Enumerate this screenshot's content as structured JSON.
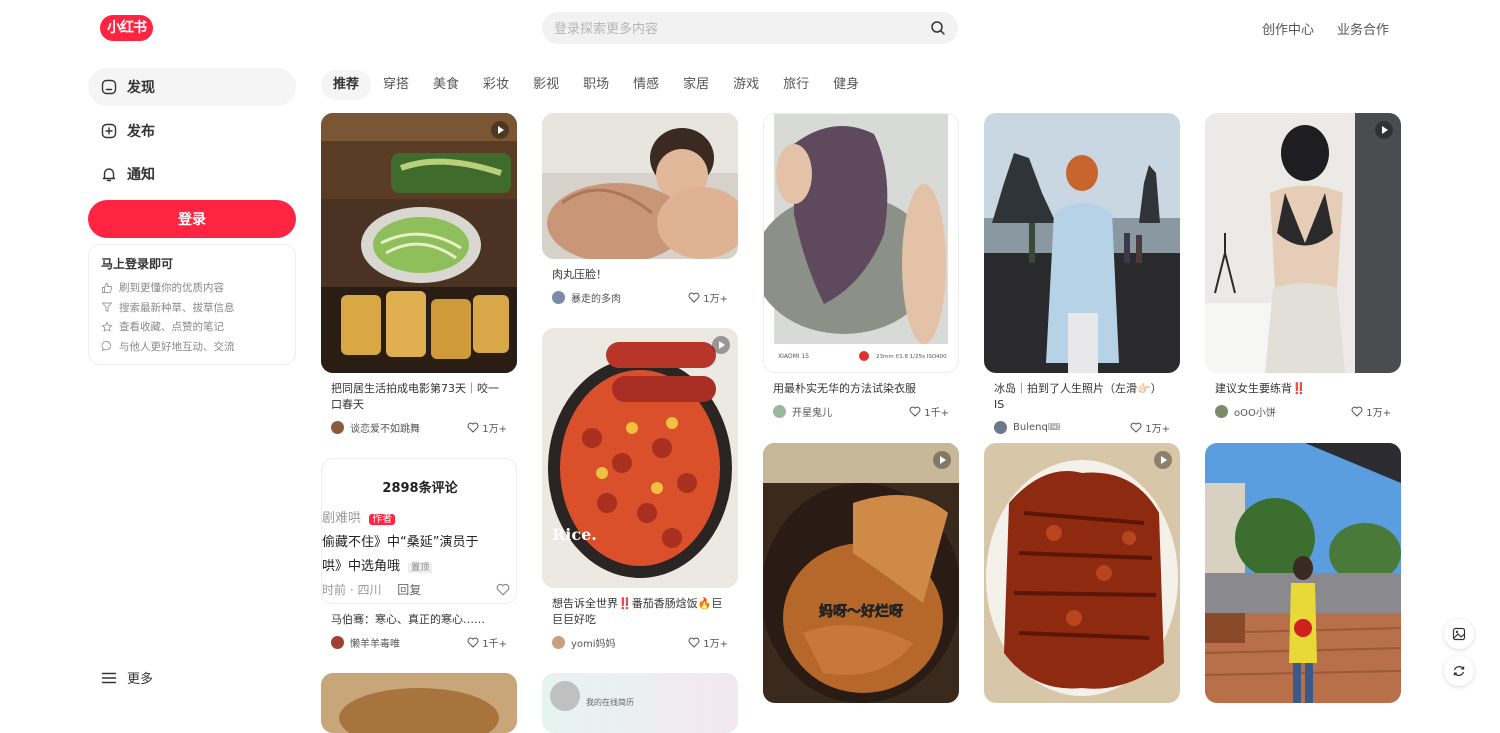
{
  "brand": {
    "logo_text": "小红书",
    "color": "#ff2442"
  },
  "search": {
    "placeholder": "登录探索更多内容"
  },
  "top_links": [
    "创作中心",
    "业务合作"
  ],
  "sidebar": {
    "items": [
      {
        "label": "发现",
        "icon": "home-icon"
      },
      {
        "label": "发布",
        "icon": "plus-square-icon"
      },
      {
        "label": "通知",
        "icon": "bell-icon"
      }
    ],
    "login_button": "登录",
    "login_card": {
      "title": "马上登录即可",
      "benefits": [
        {
          "text": "刷到更懂你的优质内容",
          "icon": "thumb-up-icon"
        },
        {
          "text": "搜索最新种草、拔草信息",
          "icon": "search-filter-icon"
        },
        {
          "text": "查看收藏、点赞的笔记",
          "icon": "star-icon"
        },
        {
          "text": "与他人更好地互动、交流",
          "icon": "chat-bubble-icon"
        }
      ]
    },
    "more": "更多"
  },
  "tabs": [
    "推荐",
    "穿搭",
    "美食",
    "彩妆",
    "影视",
    "职场",
    "情感",
    "家居",
    "游戏",
    "旅行",
    "健身"
  ],
  "feed": {
    "col1": [
      {
        "title": "把同居生活拍成电影第73天｜咬一口春天",
        "author": "谈恋爱不如跳舞",
        "likes": "1万+",
        "video": true
      },
      {
        "title": "马伯骞：寒心、真正的寒心……",
        "author": "懒羊羊毒唯",
        "likes": "1千+",
        "video": false,
        "comment_card": {
          "count": "2898条评论",
          "line1": "剧难哄",
          "tag": "作者",
          "line2": "偷藏不住》中“桑延”演员于",
          "line3": "哄》中选角哦",
          "pin": "置顶",
          "line4": "时前 · 四川",
          "reply": "回复"
        }
      }
    ],
    "col2": [
      {
        "title": "肉丸压脸！",
        "author": "暴走的多肉",
        "likes": "1万+",
        "video": false
      },
      {
        "title": "想告诉全世界‼️番茄香肠焓饭🔥巨巨巨好吃",
        "author": "yomi妈妈",
        "likes": "1万+",
        "video": true,
        "overlay": "Rice."
      },
      {
        "title": "",
        "author": "",
        "likes": "",
        "video": false,
        "overlay": "我的在线简历"
      }
    ],
    "col3": [
      {
        "title": "用最朴实无华的方法试染衣服",
        "author": "开星鬼儿",
        "likes": "1千+",
        "video": false,
        "caption_left": "XIAOMI 15",
        "caption_right": "23mm f/1.8 1/25s ISO400"
      },
      {
        "title": "",
        "author": "",
        "likes": "",
        "video": true,
        "overlay": "妈呀～好烂呀"
      }
    ],
    "col4": [
      {
        "title": "冰岛｜拍到了人生照片（左滑👉🏻）IS",
        "author": "Bulenq🎟",
        "likes": "1万+",
        "video": false
      },
      {
        "title": "",
        "author": "",
        "likes": "",
        "video": true
      }
    ],
    "col5": [
      {
        "title": "建议女生要练背‼️",
        "author": "oOO小饼",
        "likes": "1万+",
        "video": true
      },
      {
        "title": "",
        "author": "",
        "likes": "",
        "video": false
      }
    ]
  },
  "float_buttons": [
    "image-icon",
    "refresh-icon"
  ]
}
